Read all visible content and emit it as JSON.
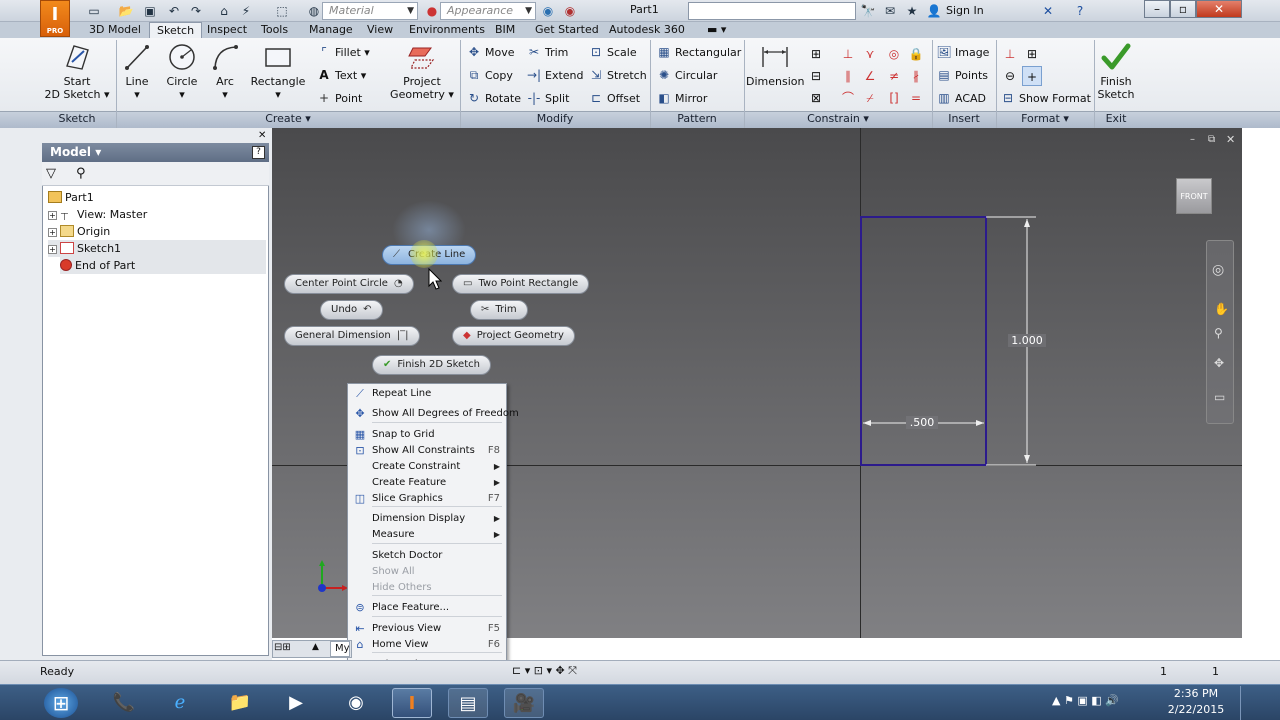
{
  "app": {
    "logo_text": "I",
    "logo_sub": "PRO"
  },
  "qat": {
    "material_placeholder": "Material",
    "appearance_placeholder": "Appearance",
    "document_title": "Part1",
    "sign_in": "Sign In"
  },
  "tabs": [
    "3D Model",
    "Sketch",
    "Inspect",
    "Tools",
    "Manage",
    "View",
    "Environments",
    "BIM",
    "Get Started",
    "Autodesk 360"
  ],
  "active_tab": "Sketch",
  "ribbon": {
    "sketch_panel": {
      "start_label_1": "Start",
      "start_label_2": "2D Sketch",
      "panel_label": "Sketch"
    },
    "create_panel": {
      "line": "Line",
      "circle": "Circle",
      "arc": "Arc",
      "rectangle": "Rectangle",
      "fillet": "Fillet",
      "text": "Text",
      "point": "Point",
      "project_1": "Project",
      "project_2": "Geometry",
      "panel_label": "Create"
    },
    "modify_panel": {
      "move": "Move",
      "trim": "Trim",
      "scale": "Scale",
      "copy": "Copy",
      "extend": "Extend",
      "stretch": "Stretch",
      "rotate": "Rotate",
      "split": "Split",
      "offset": "Offset",
      "panel_label": "Modify"
    },
    "pattern_panel": {
      "rectangular": "Rectangular",
      "circular": "Circular",
      "mirror": "Mirror",
      "panel_label": "Pattern"
    },
    "constrain_panel": {
      "dimension": "Dimension",
      "panel_label": "Constrain"
    },
    "insert_panel": {
      "image": "Image",
      "points": "Points",
      "acad": "ACAD",
      "panel_label": "Insert"
    },
    "format_panel": {
      "show_format": "Show Format",
      "panel_label": "Format"
    },
    "exit_panel": {
      "finish_1": "Finish",
      "finish_2": "Sketch",
      "panel_label": "Exit"
    }
  },
  "browser": {
    "title": "Model",
    "tree": [
      "Part1",
      "View: Master",
      "Origin",
      "Sketch1",
      "End of Part"
    ]
  },
  "viewport": {
    "viewcube_label": "FRONT",
    "dim_height": "1.000",
    "dim_width": ".500"
  },
  "marking_menu": {
    "create_line": "Create Line",
    "center_point_circle": "Center Point Circle",
    "two_point_rectangle": "Two Point Rectangle",
    "undo": "Undo",
    "trim": "Trim",
    "general_dimension": "General Dimension",
    "project_geometry": "Project Geometry",
    "finish_2d_sketch": "Finish 2D Sketch"
  },
  "context_menu": [
    {
      "label": "Repeat Line",
      "shortcut": "",
      "sub": false,
      "disabled": false,
      "icon": "line-icon"
    },
    {
      "label": "Show All Degrees of Freedom",
      "shortcut": "",
      "sub": false,
      "disabled": false,
      "icon": "dof-icon"
    },
    {
      "label": "Snap to Grid",
      "shortcut": "",
      "sub": false,
      "disabled": false,
      "icon": "grid-icon"
    },
    {
      "label": "Show All Constraints",
      "shortcut": "F8",
      "sub": false,
      "disabled": false,
      "icon": "constraints-icon"
    },
    {
      "label": "Create Constraint",
      "shortcut": "",
      "sub": true,
      "disabled": false,
      "icon": ""
    },
    {
      "label": "Create Feature",
      "shortcut": "",
      "sub": true,
      "disabled": false,
      "icon": ""
    },
    {
      "label": "Slice Graphics",
      "shortcut": "F7",
      "sub": false,
      "disabled": false,
      "icon": "slice-icon"
    },
    {
      "label": "Dimension Display",
      "shortcut": "",
      "sub": true,
      "disabled": false,
      "icon": ""
    },
    {
      "label": "Measure",
      "shortcut": "",
      "sub": true,
      "disabled": false,
      "icon": ""
    },
    {
      "label": "Sketch Doctor",
      "shortcut": "",
      "sub": false,
      "disabled": false,
      "icon": ""
    },
    {
      "label": "Show All",
      "shortcut": "",
      "sub": false,
      "disabled": true,
      "icon": ""
    },
    {
      "label": "Hide Others",
      "shortcut": "",
      "sub": false,
      "disabled": true,
      "icon": ""
    },
    {
      "label": "Place Feature...",
      "shortcut": "",
      "sub": false,
      "disabled": false,
      "icon": "place-icon"
    },
    {
      "label": "Previous View",
      "shortcut": "F5",
      "sub": false,
      "disabled": false,
      "icon": "previous-view-icon"
    },
    {
      "label": "Home View",
      "shortcut": "F6",
      "sub": false,
      "disabled": false,
      "icon": "home-icon"
    },
    {
      "label": "Help Topics...",
      "shortcut": "",
      "sub": false,
      "disabled": false,
      "icon": ""
    }
  ],
  "statusbar": {
    "status": "Ready",
    "doc_tab": "My",
    "right_1": "1",
    "right_2": "1"
  },
  "taskbar": {
    "time": "2:36 PM",
    "date": "2/22/2015"
  }
}
